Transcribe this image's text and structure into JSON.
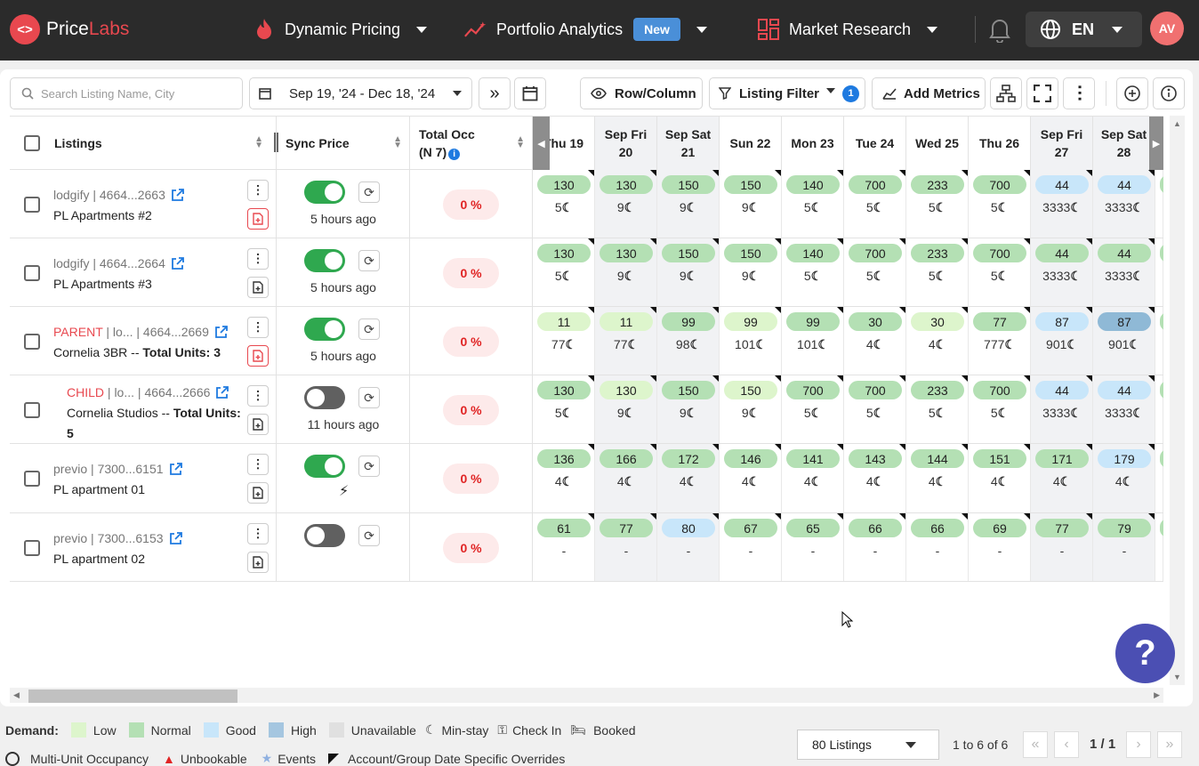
{
  "app": {
    "name_a": "Price",
    "name_b": "Labs"
  },
  "nav": {
    "dynamic_pricing": "Dynamic Pricing",
    "portfolio_analytics": "Portfolio Analytics",
    "new_badge": "New",
    "market_research": "Market Research",
    "language": "EN",
    "avatar": "AV"
  },
  "toolbar": {
    "search_placeholder": "Search Listing Name, City",
    "date_range": "Sep 19, '24 - Dec 18, '24",
    "row_column": "Row/Column",
    "listing_filter": "Listing Filter",
    "filter_count": "1",
    "add_metrics": "Add Metrics"
  },
  "headers": {
    "listings": "Listings",
    "sync_price": "Sync Price",
    "total_occ_line1": "Total Occ",
    "total_occ_line2": "(N 7)"
  },
  "dates": [
    {
      "l1": "Thu 19",
      "l2": "",
      "we": false
    },
    {
      "l1": "Sep Fri",
      "l2": "20",
      "we": true
    },
    {
      "l1": "Sep Sat",
      "l2": "21",
      "we": true
    },
    {
      "l1": "Sun 22",
      "l2": "",
      "we": false
    },
    {
      "l1": "Mon 23",
      "l2": "",
      "we": false
    },
    {
      "l1": "Tue 24",
      "l2": "",
      "we": false
    },
    {
      "l1": "Wed 25",
      "l2": "",
      "we": false
    },
    {
      "l1": "Thu 26",
      "l2": "",
      "we": false
    },
    {
      "l1": "Sep Fri",
      "l2": "27",
      "we": true
    },
    {
      "l1": "Sep Sat",
      "l2": "28",
      "we": true
    }
  ],
  "listings": [
    {
      "tag": "",
      "source": "lodgify",
      "id": "4664...2663",
      "name": "PL Apartments #2",
      "bold": "",
      "sync_on": true,
      "ago": "5 hours ago",
      "occ": "0 %",
      "red_doc": true,
      "prices": [
        "130",
        "130",
        "150",
        "150",
        "140",
        "700",
        "233",
        "700",
        "44",
        "44"
      ],
      "demand": [
        "normal",
        "normal",
        "normal",
        "normal",
        "normal",
        "normal",
        "normal",
        "normal",
        "good",
        "good"
      ],
      "minstay": [
        "5",
        "9",
        "9",
        "9",
        "5",
        "5",
        "5",
        "5",
        "3333",
        "3333"
      ]
    },
    {
      "tag": "",
      "source": "lodgify",
      "id": "4664...2664",
      "name": "PL Apartments #3",
      "bold": "",
      "sync_on": true,
      "ago": "5 hours ago",
      "occ": "0 %",
      "red_doc": false,
      "prices": [
        "130",
        "130",
        "150",
        "150",
        "140",
        "700",
        "233",
        "700",
        "44",
        "44"
      ],
      "demand": [
        "normal",
        "normal",
        "normal",
        "normal",
        "normal",
        "normal",
        "normal",
        "normal",
        "normal",
        "normal"
      ],
      "minstay": [
        "5",
        "9",
        "9",
        "9",
        "5",
        "5",
        "5",
        "5",
        "3333",
        "3333"
      ]
    },
    {
      "tag": "PARENT",
      "source": "lo...",
      "id": "4664...2669",
      "name": "Cornelia 3BR -- ",
      "bold": "Total Units: 3",
      "sync_on": true,
      "ago": "5 hours ago",
      "occ": "0 %",
      "red_doc": true,
      "prices": [
        "11",
        "11",
        "99",
        "99",
        "99",
        "30",
        "30",
        "77",
        "87",
        "87"
      ],
      "demand": [
        "low",
        "low",
        "normal",
        "low",
        "normal",
        "normal",
        "low",
        "normal",
        "good",
        "high"
      ],
      "minstay": [
        "77",
        "77",
        "98",
        "101",
        "101",
        "4",
        "4",
        "777",
        "901",
        "901"
      ]
    },
    {
      "tag": "CHILD",
      "source": "lo...",
      "id": "4664...2666",
      "name": "Cornelia Studios -- ",
      "bold": "Total Units: 5",
      "sync_on": false,
      "ago": "11 hours ago",
      "occ": "0 %",
      "red_doc": false,
      "prices": [
        "130",
        "130",
        "150",
        "150",
        "700",
        "700",
        "233",
        "700",
        "44",
        "44"
      ],
      "demand": [
        "normal",
        "low",
        "normal",
        "low",
        "normal",
        "normal",
        "normal",
        "normal",
        "good",
        "good"
      ],
      "minstay": [
        "5",
        "9",
        "9",
        "9",
        "5",
        "5",
        "5",
        "5",
        "3333",
        "3333"
      ]
    },
    {
      "tag": "",
      "source": "previo",
      "id": "7300...6151",
      "name": "PL apartment 01",
      "bold": "",
      "sync_on": true,
      "ago": "",
      "occ": "0 %",
      "red_doc": false,
      "prices": [
        "136",
        "166",
        "172",
        "146",
        "141",
        "143",
        "144",
        "151",
        "171",
        "179"
      ],
      "demand": [
        "normal",
        "normal",
        "normal",
        "normal",
        "normal",
        "normal",
        "normal",
        "normal",
        "normal",
        "good"
      ],
      "minstay": [
        "4",
        "4",
        "4",
        "4",
        "4",
        "4",
        "4",
        "4",
        "4",
        "4"
      ]
    },
    {
      "tag": "",
      "source": "previo",
      "id": "7300...6153",
      "name": "PL apartment 02",
      "bold": "",
      "sync_on": false,
      "ago": "",
      "occ": "0 %",
      "red_doc": false,
      "prices": [
        "61",
        "77",
        "80",
        "67",
        "65",
        "66",
        "66",
        "69",
        "77",
        "79"
      ],
      "demand": [
        "normal",
        "normal",
        "good",
        "normal",
        "normal",
        "normal",
        "normal",
        "normal",
        "normal",
        "normal"
      ],
      "minstay": [
        "-",
        "-",
        "-",
        "-",
        "-",
        "-",
        "-",
        "-",
        "-",
        "-"
      ]
    }
  ],
  "legend": {
    "demand": "Demand:",
    "low": "Low",
    "normal": "Normal",
    "good": "Good",
    "high": "High",
    "unavailable": "Unavailable",
    "minstay": "Min-stay",
    "checkin": "Check In",
    "booked": "Booked",
    "multi": "Multi-Unit Occupancy",
    "unbookable": "Unbookable",
    "events": "Events",
    "overrides": "Account/Group Date Specific Overrides"
  },
  "pagination": {
    "per_page": "80 Listings",
    "range": "1 to 6 of 6",
    "page": "1 / 1"
  },
  "colors": {
    "low": "#ddf5cc",
    "normal": "#b4e0b4",
    "good": "#c8e6fa",
    "high": "#8fb9d6",
    "unavailable": "#e0e0e0",
    "accent": "#e8484f"
  }
}
